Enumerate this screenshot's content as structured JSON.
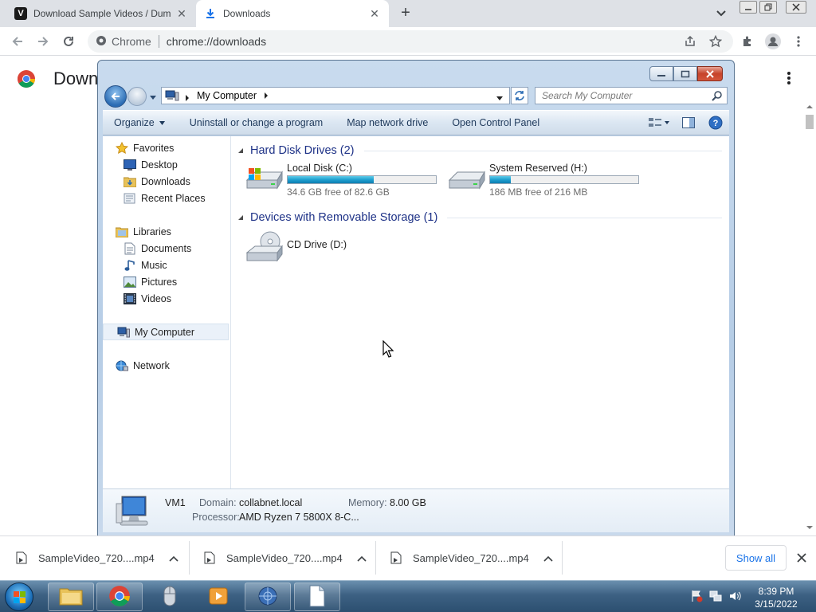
{
  "browser": {
    "tabs": [
      {
        "title": "Download Sample Videos / Dum",
        "favicon": "v-logo-icon"
      },
      {
        "title": "Downloads",
        "favicon": "download-icon",
        "active": true
      }
    ],
    "omnibox": {
      "site_label": "Chrome",
      "url": "chrome://downloads"
    }
  },
  "page": {
    "title": "Down"
  },
  "explorer": {
    "address": {
      "location": "My Computer"
    },
    "search": {
      "placeholder": "Search My Computer"
    },
    "commands": [
      "Organize",
      "Uninstall or change a program",
      "Map network drive",
      "Open Control Panel"
    ],
    "nav": {
      "favorites": {
        "label": "Favorites",
        "items": [
          "Desktop",
          "Downloads",
          "Recent Places"
        ]
      },
      "libraries": {
        "label": "Libraries",
        "items": [
          "Documents",
          "Music",
          "Pictures",
          "Videos"
        ]
      },
      "computer": "My Computer",
      "network": "Network"
    },
    "groups": {
      "hdd": {
        "title": "Hard Disk Drives (2)",
        "drives": [
          {
            "name": "Local Disk (C:)",
            "free": "34.6 GB free of 82.6 GB",
            "used_fraction": 0.58
          },
          {
            "name": "System Reserved (H:)",
            "free": "186 MB free of 216 MB",
            "used_fraction": 0.14
          }
        ]
      },
      "removable": {
        "title": "Devices with Removable Storage (1)",
        "drives": [
          {
            "name": "CD Drive (D:)"
          }
        ]
      }
    },
    "details": {
      "name": "VM1",
      "domain_label": "Domain:",
      "domain": "collabnet.local",
      "memory_label": "Memory:",
      "memory": "8.00 GB",
      "processor_label": "Processor:",
      "processor": "AMD Ryzen 7 5800X 8-C..."
    }
  },
  "downloads": {
    "items": [
      "SampleVideo_720....mp4",
      "SampleVideo_720....mp4",
      "SampleVideo_720....mp4"
    ],
    "show_all": "Show all"
  },
  "taskbar": {
    "time": "8:39 PM",
    "date": "3/15/2022"
  },
  "colors": {
    "accent_blue": "#1a73e8",
    "drive_bar": "#1fa0d0",
    "group_header": "#1e3287"
  }
}
